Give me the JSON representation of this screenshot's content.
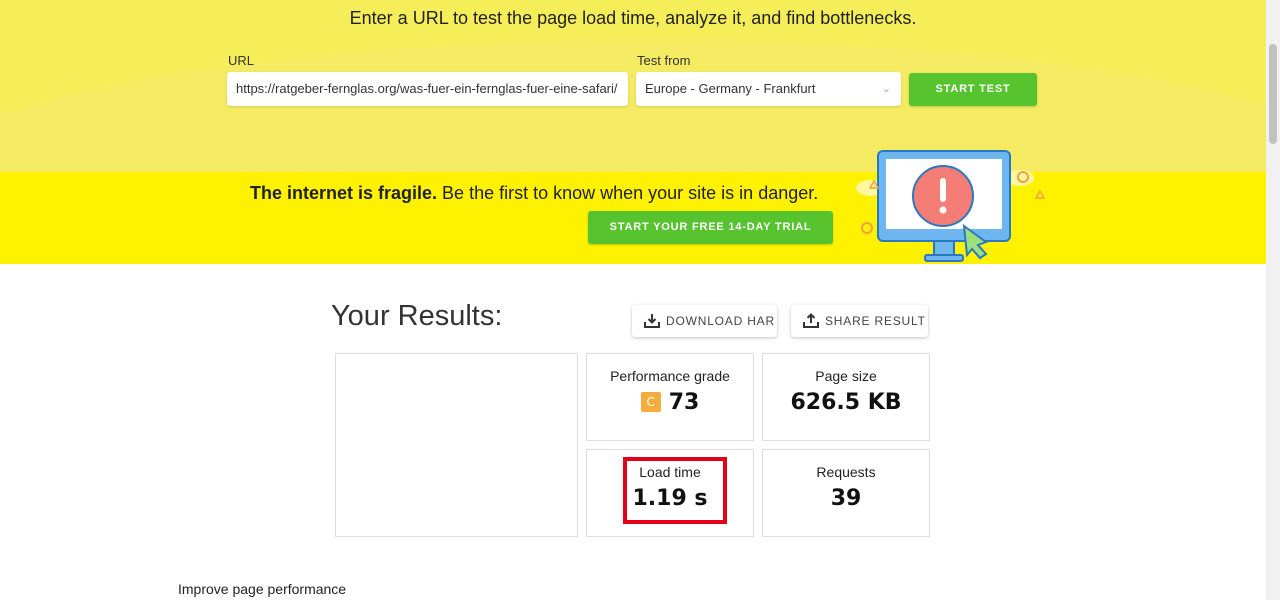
{
  "hero": {
    "headline": "Enter a URL to test the page load time, analyze it, and find bottlenecks.",
    "url_label": "URL",
    "url_value": "https://ratgeber-fernglas.org/was-fuer-ein-fernglas-fuer-eine-safari/",
    "location_label": "Test from",
    "location_value": "Europe - Germany - Frankfurt",
    "start_label": "START TEST"
  },
  "promo": {
    "bold": "The internet is fragile.",
    "text": " Be the first to know when your site is in danger.",
    "cta": "START YOUR FREE 14-DAY TRIAL"
  },
  "results": {
    "title": "Your Results:",
    "download": "DOWNLOAD HAR",
    "share": "SHARE RESULT",
    "cards": [
      {
        "title": "Performance grade",
        "grade": "C",
        "value": "73"
      },
      {
        "title": "Page size",
        "value": "626.5 KB"
      },
      {
        "title": "Load time",
        "value": "1.19 s"
      },
      {
        "title": "Requests",
        "value": "39"
      }
    ]
  },
  "improve": "Improve page performance",
  "colors": {
    "green": "#57c32f",
    "yellow": "#fff200",
    "grade": "#f4ad3d",
    "highlight": "#e3001b"
  }
}
